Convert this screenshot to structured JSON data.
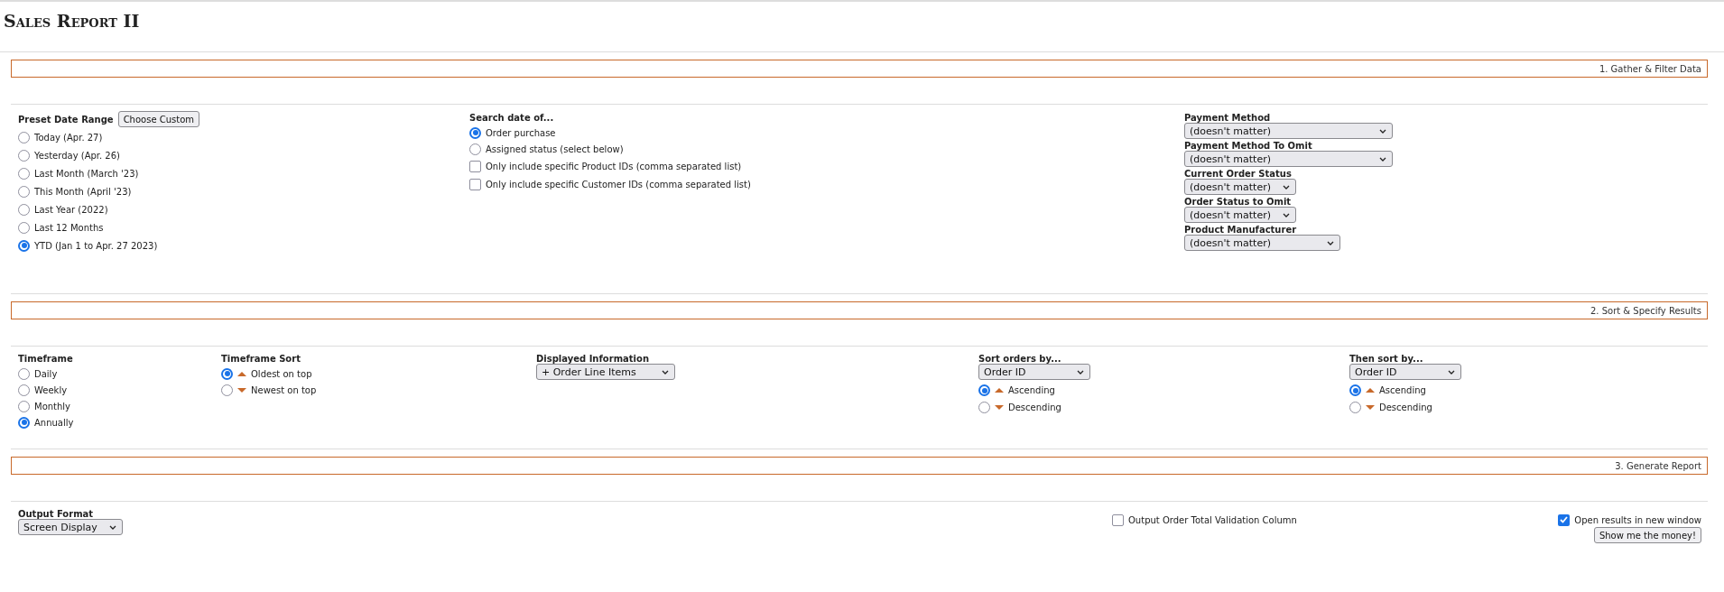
{
  "title": "Sales Report II",
  "gather": {
    "heading": "1. Gather & Filter Data",
    "preset": {
      "label": "Preset Date Range",
      "button": "Choose Custom",
      "options": [
        {
          "label": "Today (Apr. 27)",
          "selected": false
        },
        {
          "label": "Yesterday (Apr. 26)",
          "selected": false
        },
        {
          "label": "Last Month (March '23)",
          "selected": false
        },
        {
          "label": "This Month (April '23)",
          "selected": false
        },
        {
          "label": "Last Year (2022)",
          "selected": false
        },
        {
          "label": "Last 12 Months",
          "selected": false
        },
        {
          "label": "YTD (Jan 1 to Apr. 27 2023)",
          "selected": true
        }
      ]
    },
    "search_date": {
      "label": "Search date of...",
      "options": [
        {
          "label": "Order purchase",
          "selected": true
        },
        {
          "label": "Assigned status (select below)",
          "selected": false
        }
      ],
      "checkboxes": [
        {
          "label": "Only include specific Product IDs (comma separated list)",
          "checked": false
        },
        {
          "label": "Only include specific Customer IDs (comma separated list)",
          "checked": false
        }
      ]
    },
    "filters": [
      {
        "label": "Payment Method",
        "value": "(doesn't matter)"
      },
      {
        "label": "Payment Method To Omit",
        "value": "(doesn't matter)"
      },
      {
        "label": "Current Order Status",
        "value": "(doesn't matter)"
      },
      {
        "label": "Order Status to Omit",
        "value": "(doesn't matter)"
      },
      {
        "label": "Product Manufacturer",
        "value": "(doesn't matter)"
      }
    ]
  },
  "sort": {
    "heading": "2. Sort & Specify Results",
    "timeframe": {
      "label": "Timeframe",
      "options": [
        {
          "label": "Daily",
          "selected": false
        },
        {
          "label": "Weekly",
          "selected": false
        },
        {
          "label": "Monthly",
          "selected": false
        },
        {
          "label": "Annually",
          "selected": true
        }
      ]
    },
    "timeframe_sort": {
      "label": "Timeframe Sort",
      "options": [
        {
          "label": "Oldest on top",
          "kind": "up",
          "selected": true
        },
        {
          "label": "Newest on top",
          "kind": "down",
          "selected": false
        }
      ]
    },
    "displayed": {
      "label": "Displayed Information",
      "value": "+ Order Line Items"
    },
    "sort_groups": [
      {
        "label": "Sort orders by...",
        "value": "Order ID",
        "options": [
          {
            "label": "Ascending",
            "kind": "up",
            "selected": true
          },
          {
            "label": "Descending",
            "kind": "down",
            "selected": false
          }
        ]
      },
      {
        "label": "Then sort by...",
        "value": "Order ID",
        "options": [
          {
            "label": "Ascending",
            "kind": "up",
            "selected": true
          },
          {
            "label": "Descending",
            "kind": "down",
            "selected": false
          }
        ]
      }
    ]
  },
  "generate": {
    "heading": "3. Generate Report",
    "output_format": {
      "label": "Output Format",
      "value": "Screen Display"
    },
    "validation": {
      "label": "Output Order Total Validation Column",
      "checked": false
    },
    "new_window": {
      "label": "Open results in new window",
      "checked": true
    },
    "button": "Show me the money!"
  }
}
